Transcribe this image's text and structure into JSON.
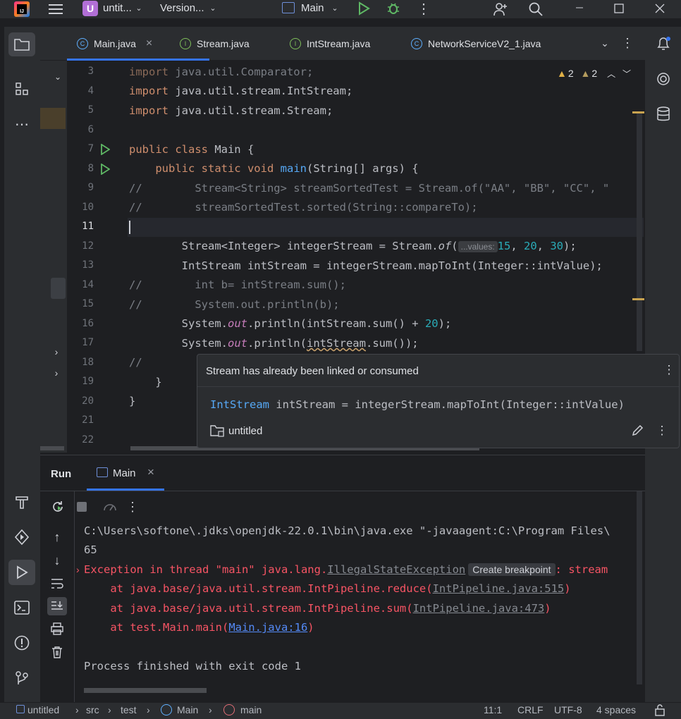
{
  "titlebar": {
    "project_badge": "U",
    "project": "untit...",
    "vcs": "Version...",
    "run_config": "Main"
  },
  "tabs": [
    {
      "label": "Main.java",
      "icon": "class-icon"
    },
    {
      "label": "Stream.java",
      "icon": "interface-icon"
    },
    {
      "label": "IntStream.java",
      "icon": "interface-icon"
    },
    {
      "label": "NetworkServiceV2_1.java",
      "icon": "class-icon"
    }
  ],
  "inspections": {
    "warnings": "2",
    "weak_warnings": "2"
  },
  "editor": {
    "line_numbers": [
      "3",
      "4",
      "5",
      "6",
      "7",
      "8",
      "9",
      "10",
      "11",
      "12",
      "13",
      "14",
      "15",
      "16",
      "17",
      "18",
      "19",
      "20",
      "21",
      "22"
    ],
    "inlay_hint": "...values:"
  },
  "popup": {
    "title": "Stream has already been linked or consumed",
    "code_type": "IntStream",
    "code_rest": " intStream = integerStream.mapToInt(Integer::intValue)",
    "module": "untitled"
  },
  "run": {
    "panel_label": "Run",
    "tab_label": "Main",
    "cmd": "C:\\Users\\softone\\.jdks\\openjdk-22.0.1\\bin\\java.exe \"-javaagent:C:\\Program Files\\",
    "out1": "65",
    "exc_prefix": "Exception in thread \"main\" java.lang.",
    "exc_class": "IllegalStateException",
    "create_breakpoint": "Create breakpoint",
    "exc_suffix": ": stream",
    "st1_prefix": "    at java.base/java.util.stream.IntPipeline.reduce(",
    "st1_link": "IntPipeline.java:515",
    "st2_prefix": "    at java.base/java.util.stream.IntPipeline.sum(",
    "st2_link": "IntPipeline.java:473",
    "st3_prefix": "    at test.Main.main(",
    "st3_link": "Main.java:16",
    "close_paren": ")",
    "finished": "Process finished with exit code 1"
  },
  "statusbar": {
    "project": "untitled",
    "src": "src",
    "pkg": "test",
    "cls": "Main",
    "method": "main",
    "position": "11:1",
    "line_sep": "CRLF",
    "encoding": "UTF-8",
    "indent": "4 spaces"
  }
}
